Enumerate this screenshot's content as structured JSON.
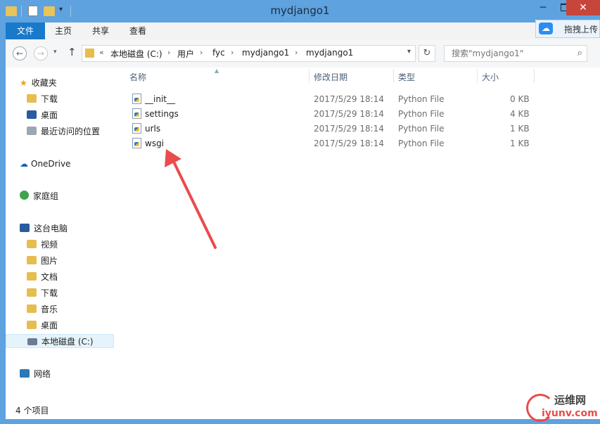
{
  "window": {
    "title": "mydjango1",
    "minimize": "─",
    "close": "✕"
  },
  "ribbon": {
    "tabs": [
      {
        "label": "文件"
      },
      {
        "label": "主页"
      },
      {
        "label": "共享"
      },
      {
        "label": "查看"
      }
    ],
    "upload_label": "拖拽上传"
  },
  "address": {
    "back": "←",
    "forward": "→",
    "up": "↑",
    "overflow": "«",
    "crumbs": [
      "本地磁盘 (C:)",
      "用户",
      "fyc",
      "mydjango1",
      "mydjango1"
    ],
    "separator": "›",
    "refresh": "↻"
  },
  "search": {
    "placeholder": "搜索\"mydjango1\""
  },
  "sidebar": {
    "favorites": "收藏夹",
    "favorites_items": [
      "下载",
      "桌面",
      "最近访问的位置"
    ],
    "onedrive": "OneDrive",
    "homegroup": "家庭组",
    "thispc": "这台电脑",
    "thispc_items": [
      "视频",
      "图片",
      "文档",
      "下载",
      "音乐",
      "桌面",
      "本地磁盘 (C:)"
    ],
    "network": "网络"
  },
  "columns": {
    "name": "名称",
    "modified": "修改日期",
    "type": "类型",
    "size": "大小"
  },
  "files": [
    {
      "name": "__init__",
      "modified": "2017/5/29 18:14",
      "type": "Python File",
      "size": "0 KB"
    },
    {
      "name": "settings",
      "modified": "2017/5/29 18:14",
      "type": "Python File",
      "size": "4 KB"
    },
    {
      "name": "urls",
      "modified": "2017/5/29 18:14",
      "type": "Python File",
      "size": "1 KB"
    },
    {
      "name": "wsgi",
      "modified": "2017/5/29 18:14",
      "type": "Python File",
      "size": "1 KB"
    }
  ],
  "status": {
    "item_count": "4 个项目"
  },
  "watermark": {
    "top": "运维网",
    "bottom": "iyunv.com"
  },
  "colors": {
    "accent": "#1979ca",
    "titlebar": "#5ea2df",
    "close": "#c7463b",
    "annotation_arrow": "#e94c4c"
  }
}
